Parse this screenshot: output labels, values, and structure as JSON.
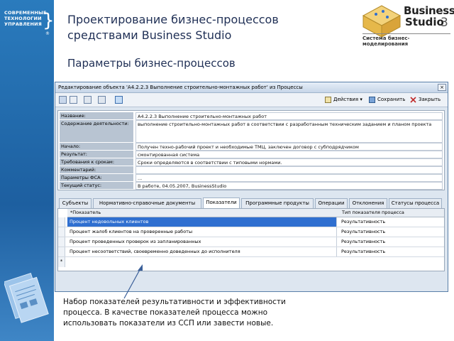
{
  "brand_left": {
    "lines": [
      "СОВРЕМЕННЫЕ",
      "ТЕХНОЛОГИИ",
      "УПРАВЛЕНИЯ"
    ],
    "registered": "®"
  },
  "brand_right": {
    "line1": "Business",
    "line2": "Studio",
    "version": "3",
    "tagline": "Система бизнес-моделирования"
  },
  "header": {
    "title_line1": "Проектирование бизнес-процессов",
    "title_line2": "средствами Business Studio",
    "subtitle": "Параметры бизнес-процессов"
  },
  "window": {
    "title": "Редактирование объекта 'А4.2.2.3 Выполнение строительно-монтажных работ' из Процессы",
    "close": "×",
    "toolbar": {
      "actions": "Действия",
      "save": "Сохранить",
      "close": "Закрыть"
    },
    "fields": [
      {
        "label": "Название:",
        "value": "А4.2.2.3 Выполнение строительно-монтажных работ"
      },
      {
        "label": "Содержание деятельности:",
        "value": "выполнение строительно-монтажных работ в соответствии с разработанным техническим заданием и планом проекта"
      },
      {
        "label": "Начало:",
        "value": "Получен техно-рабочий проект и необходимые ТМЦ, заключен договор с субподрядчиком"
      },
      {
        "label": "Результат:",
        "value": "смонтированная система"
      },
      {
        "label": "Требования к срокам:",
        "value": "Сроки определяются в соответствии с типовыми нормами."
      },
      {
        "label": "Комментарий:",
        "value": ""
      },
      {
        "label": "Параметры ФСА:",
        "value": "..."
      },
      {
        "label": "Текущий статус:",
        "value": "В работе, 04.05.2007, BusinessStudio"
      }
    ],
    "tabs": [
      "Субъекты",
      "Нормативно-справочные документы",
      "Показатели",
      "Программные продукты",
      "Операции",
      "Отклонения",
      "Статусы процесса"
    ],
    "active_tab": "Показатели",
    "grid": {
      "col_indicator": "*Показатель",
      "col_type": "Тип показателя процесса",
      "rows": [
        {
          "indicator": "Процент недовольных клиентов",
          "type": "Результативность"
        },
        {
          "indicator": "Процент жалоб клиентов на проверенные работы",
          "type": "Результативность"
        },
        {
          "indicator": "Процент проведенных проверок из запланированных",
          "type": "Результативность"
        },
        {
          "indicator": "Процент несоответствий, своевременно доведенных до исполнителя",
          "type": "Результативность"
        }
      ],
      "new_row_marker": "*"
    }
  },
  "annotation": {
    "line1": "Набор показателей результативности и эффективности",
    "line2": "процесса. В качестве показателей  процесса можно",
    "line3": "использовать показатели из ССП или завести новые."
  },
  "colors": {
    "sidebar": "#1d5fa0",
    "title_text": "#1f2f55",
    "selection": "#2f6fd0",
    "label_bg": "#b8c4d2"
  }
}
